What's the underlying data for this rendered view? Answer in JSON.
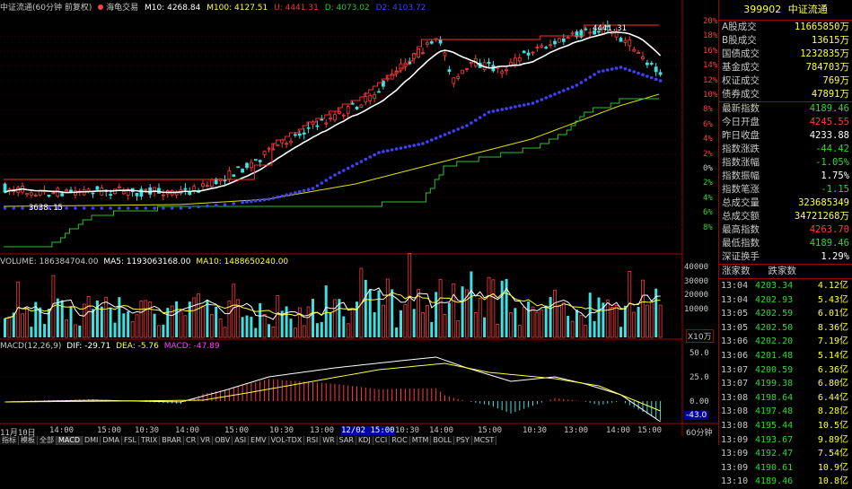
{
  "header": {
    "title": "中证流通(60分钟 前复权)",
    "indicator_name": "海龟交易",
    "m10": "M10: 4268.84",
    "m100": "M100: 4127.51",
    "u": "U: 4441.31",
    "d": "D: 4073.02",
    "d2": "D2: 4103.72"
  },
  "price_chart": {
    "peak_label": "4441.31",
    "low_label": "3638.15",
    "pct_ticks": [
      "20%",
      "18%",
      "16%",
      "14%",
      "12%",
      "10%",
      "8%",
      "6%",
      "4%",
      "2%",
      "0%",
      "2%",
      "4%",
      "6%",
      "8%"
    ]
  },
  "volume_panel": {
    "title": "VOLUME: 186384704.00",
    "ma5": "MA5: 1193063168.00",
    "ma10": "MA10: 1488650240.00",
    "ticks": [
      "40000",
      "30000",
      "20000",
      "10000"
    ],
    "unit": "X10万"
  },
  "macd_panel": {
    "title": "MACD(12,26,9)",
    "dif": "DIF: -29.71",
    "dea": "DEA: -5.76",
    "macd": "MACD: -47.89",
    "ticks": [
      "50.0",
      "25.0",
      "0.00"
    ],
    "cur": "-43.0"
  },
  "time_axis": [
    "11月10日",
    "14:00",
    "15:00",
    "10:30",
    "14:00",
    "15:00",
    "10:30",
    "13:00",
    "15:00",
    "10:30",
    "12/02 15:00",
    "14:00",
    "15:00",
    "10:30",
    "13:00",
    "14:00",
    "15:00"
  ],
  "period": "60分钟",
  "toolbar": [
    "指标",
    "模板",
    "全部",
    "MACD",
    "DMI",
    "DMA",
    "FSL",
    "TRIX",
    "BRAR",
    "CR",
    "VR",
    "OBV",
    "ASI",
    "EMV",
    "VOL-TDX",
    "RSI",
    "WR",
    "SAR",
    "KDJ",
    "CCI",
    "ROC",
    "MTM",
    "BOLL",
    "PSY",
    "MCST"
  ],
  "info": {
    "code": "399902",
    "name": "中证流通",
    "rows1": [
      {
        "label": "A股成交",
        "value": "11665850万",
        "color": "yellow"
      },
      {
        "label": "B股成交",
        "value": "13615万",
        "color": "yellow"
      },
      {
        "label": "国债成交",
        "value": "1232835万",
        "color": "yellow"
      },
      {
        "label": "基金成交",
        "value": "784703万",
        "color": "yellow"
      },
      {
        "label": "权证成交",
        "value": "769万",
        "color": "yellow"
      },
      {
        "label": "债券成交",
        "value": "47891万",
        "color": "yellow"
      }
    ],
    "rows2": [
      {
        "label": "最新指数",
        "value": "4189.46",
        "color": "green"
      },
      {
        "label": "今日开盘",
        "value": "4245.55",
        "color": "red"
      },
      {
        "label": "昨日收盘",
        "value": "4233.88",
        "color": "white"
      },
      {
        "label": "指数涨跌",
        "value": "-44.42",
        "color": "green"
      },
      {
        "label": "指数涨幅",
        "value": "-1.05%",
        "color": "green"
      },
      {
        "label": "指数振幅",
        "value": "1.75%",
        "color": "white"
      },
      {
        "label": "指数笔涨",
        "value": "-1.15",
        "color": "green"
      },
      {
        "label": "总成交量",
        "value": "323685349",
        "color": "yellow"
      },
      {
        "label": "总成交额",
        "value": "34721268万",
        "color": "yellow"
      },
      {
        "label": "最高指数",
        "value": "4263.70",
        "color": "red"
      },
      {
        "label": "最低指数",
        "value": "4189.46",
        "color": "green"
      },
      {
        "label": "深证换手",
        "value": "1.29%",
        "color": "white"
      }
    ],
    "updown_labels": [
      "涨家数",
      "跌家数"
    ],
    "ticks": [
      {
        "time": "13:04",
        "price": "4203.34",
        "vol": "4.12亿"
      },
      {
        "time": "13:04",
        "price": "4202.93",
        "vol": "5.43亿"
      },
      {
        "time": "13:05",
        "price": "4202.59",
        "vol": "6.01亿"
      },
      {
        "time": "13:05",
        "price": "4202.50",
        "vol": "8.36亿"
      },
      {
        "time": "13:06",
        "price": "4202.20",
        "vol": "7.19亿"
      },
      {
        "time": "13:06",
        "price": "4201.48",
        "vol": "5.14亿"
      },
      {
        "time": "13:07",
        "price": "4200.59",
        "vol": "6.36亿"
      },
      {
        "time": "13:07",
        "price": "4199.38",
        "vol": "6.80亿"
      },
      {
        "time": "13:08",
        "price": "4198.64",
        "vol": "6.44亿"
      },
      {
        "time": "13:08",
        "price": "4197.48",
        "vol": "8.28亿"
      },
      {
        "time": "13:08",
        "price": "4195.44",
        "vol": "10.5亿"
      },
      {
        "time": "13:09",
        "price": "4193.67",
        "vol": "9.89亿"
      },
      {
        "time": "13:09",
        "price": "4192.47",
        "vol": "7.54亿"
      },
      {
        "time": "13:09",
        "price": "4190.61",
        "vol": "10.9亿"
      },
      {
        "time": "13:10",
        "price": "4189.46",
        "vol": "10.8亿"
      }
    ]
  }
}
